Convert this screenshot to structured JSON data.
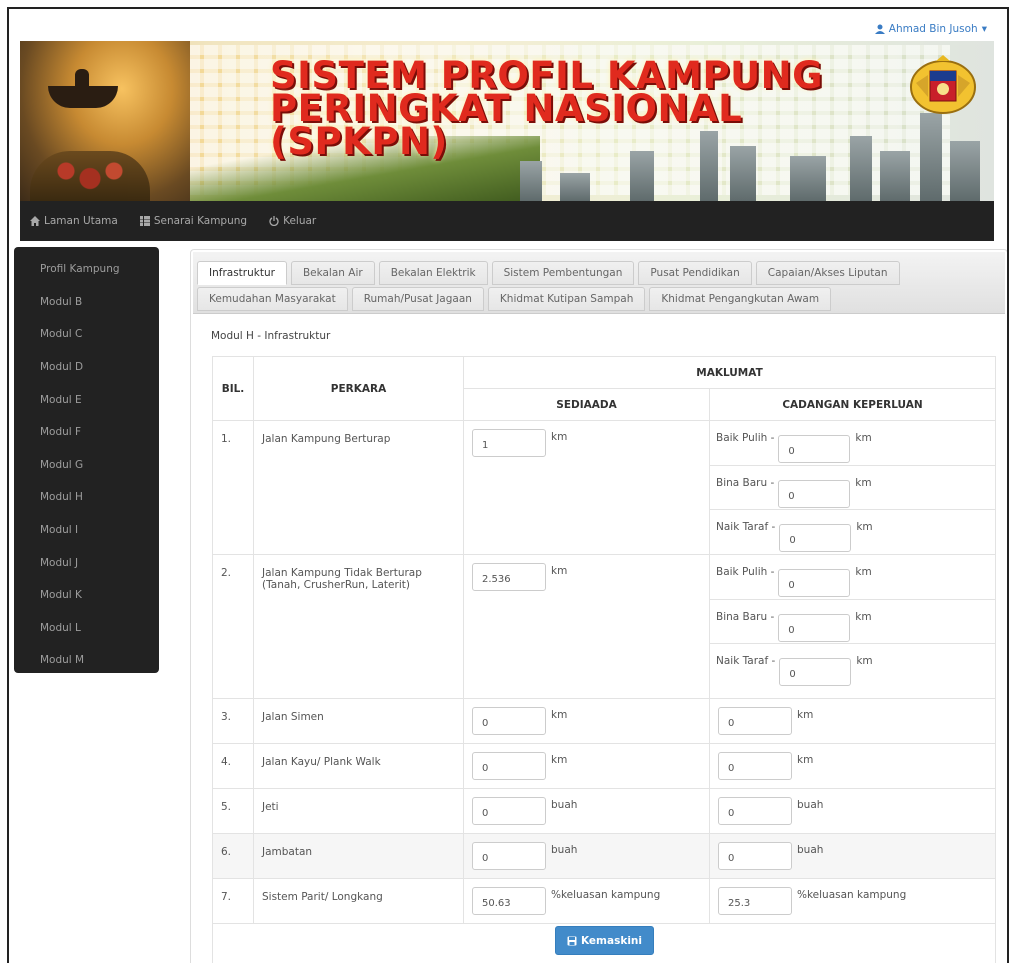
{
  "user": {
    "name": "Ahmad Bin Jusoh",
    "caret": "▾"
  },
  "banner": {
    "title_line1": "SISTEM PROFIL KAMPUNG",
    "title_line2": "PERINGKAT NASIONAL",
    "title_line3": "(SPKPN)"
  },
  "nav": [
    {
      "label": "Laman Utama",
      "icon": "home-icon"
    },
    {
      "label": "Senarai Kampung",
      "icon": "list-icon"
    },
    {
      "label": "Keluar",
      "icon": "power-icon"
    }
  ],
  "sidebar": [
    "Profil Kampung",
    "Modul B",
    "Modul C",
    "Modul D",
    "Modul E",
    "Modul F",
    "Modul G",
    "Modul H",
    "Modul I",
    "Modul J",
    "Modul K",
    "Modul L",
    "Modul M"
  ],
  "tabs_row1": [
    "Infrastruktur",
    "Bekalan Air",
    "Bekalan Elektrik",
    "Sistem Pembentungan",
    "Pusat Pendidikan",
    "Capaian/Akses Liputan"
  ],
  "tabs_row2": [
    "Kemudahan Masyarakat",
    "Rumah/Pusat Jagaan",
    "Khidmat Kutipan Sampah",
    "Khidmat Pengangkutan Awam"
  ],
  "module_title": "Modul H - Infrastruktur",
  "table": {
    "h_bil": "BIL.",
    "h_perkara": "PERKARA",
    "h_maklumat": "MAKLUMAT",
    "h_sediaada": "SEDIAADA",
    "h_cadangan": "CADANGAN KEPERLUAN",
    "cad_labels": [
      "Baik Pulih -",
      "Bina Baru -",
      "Naik Taraf -"
    ],
    "rows": [
      {
        "bil": "1.",
        "perkara": "Jalan Kampung Berturap",
        "sediaada": "1",
        "unit": "km",
        "cad": [
          "0",
          "0",
          "0"
        ],
        "cad_unit": "km"
      },
      {
        "bil": "2.",
        "perkara": "Jalan Kampung Tidak Berturap (Tanah, CrusherRun, Laterit)",
        "sediaada": "2.536",
        "unit": "km",
        "cad": [
          "0",
          "0",
          "0"
        ],
        "cad_unit": "km"
      },
      {
        "bil": "3.",
        "perkara": "Jalan Simen",
        "sediaada": "0",
        "unit": "km",
        "cad_single": "0",
        "cad_unit": "km"
      },
      {
        "bil": "4.",
        "perkara": "Jalan Kayu/ Plank Walk",
        "sediaada": "0",
        "unit": "km",
        "cad_single": "0",
        "cad_unit": "km"
      },
      {
        "bil": "5.",
        "perkara": "Jeti",
        "sediaada": "0",
        "unit": "buah",
        "cad_single": "0",
        "cad_unit": "buah"
      },
      {
        "bil": "6.",
        "perkara": "Jambatan",
        "sediaada": "0",
        "unit": "buah",
        "cad_single": "0",
        "cad_unit": "buah"
      },
      {
        "bil": "7.",
        "perkara": "Sistem Parit/ Longkang",
        "sediaada": "50.63",
        "unit": "%keluasan kampung",
        "cad_single": "25.3",
        "cad_unit": "%keluasan kampung"
      }
    ]
  },
  "save_button": "Kemaskini",
  "colors": {
    "accent": "#428bca",
    "navbar": "#222222",
    "banner_title": "#e02a1e"
  }
}
